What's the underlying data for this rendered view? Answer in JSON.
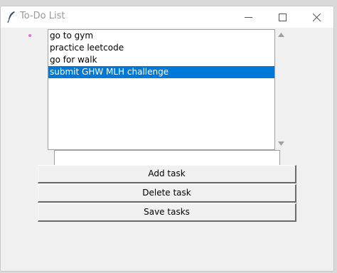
{
  "window": {
    "title": "To-Do List",
    "icons": {
      "app": "feather-icon",
      "minimize": "minimize-icon",
      "maximize": "maximize-icon",
      "close": "close-icon"
    }
  },
  "tasks": {
    "items": [
      {
        "label": "go to gym",
        "selected": false
      },
      {
        "label": "practice leetcode",
        "selected": false
      },
      {
        "label": "go for walk",
        "selected": false
      },
      {
        "label": "submit GHW MLH challenge",
        "selected": true
      }
    ]
  },
  "entry": {
    "value": "",
    "placeholder": ""
  },
  "buttons": {
    "add_label": "Add task",
    "delete_label": "Delete task",
    "save_label": "Save tasks"
  },
  "colors": {
    "selection": "#0078d7",
    "dot": "#e46be6"
  }
}
